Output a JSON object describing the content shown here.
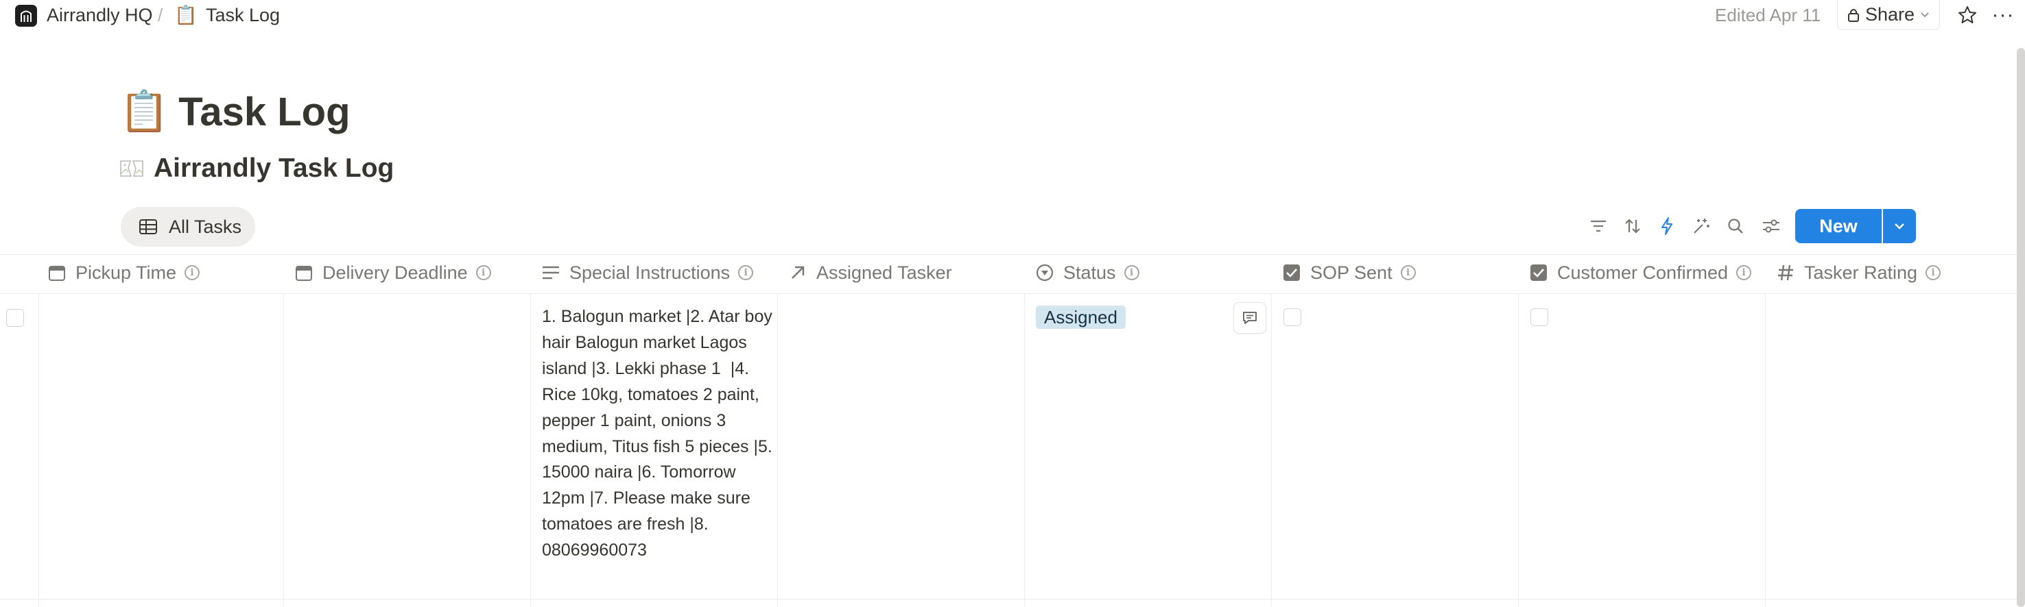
{
  "breadcrumb": {
    "workspace": "Airrandly HQ",
    "separator": "/",
    "page_emoji": "📋",
    "page": "Task Log"
  },
  "topbar": {
    "edited": "Edited Apr 11",
    "share_label": "Share",
    "more_label": "···"
  },
  "page": {
    "emoji": "📋",
    "title": "Task Log"
  },
  "database": {
    "title": "Airrandly Task Log"
  },
  "view_tab": {
    "label": "All Tasks"
  },
  "toolbar": {
    "new_label": "New",
    "accent_color": "#2383e2"
  },
  "columns": [
    {
      "label": "Pickup Time",
      "icon": "calendar-icon"
    },
    {
      "label": "Delivery Deadline",
      "icon": "calendar-icon"
    },
    {
      "label": "Special Instructions",
      "icon": "text-lines-icon"
    },
    {
      "label": "Assigned Tasker",
      "icon": "relation-arrow-icon"
    },
    {
      "label": "Status",
      "icon": "status-icon"
    },
    {
      "label": "SOP Sent",
      "icon": "checkbox-icon"
    },
    {
      "label": "Customer Confirmed",
      "icon": "checkbox-icon"
    },
    {
      "label": "Tasker Rating",
      "icon": "number-icon"
    }
  ],
  "rows": [
    {
      "pickup_time": "",
      "delivery_deadline": "",
      "special_instructions": "1. Balogun market |2. Atar boy hair Balogun market Lagos island |3. Lekki phase 1  |4. Rice 10kg, tomatoes 2 paint, pepper 1 paint, onions 3 medium, Titus fish 5 pieces |5. 15000 naira |6. Tomorrow 12pm |7. Please make sure tomatoes are fresh |8. 08069960073",
      "assigned_tasker": "",
      "status": "Assigned",
      "status_color": "#d3e5ef",
      "sop_sent": false,
      "customer_confirmed": false,
      "tasker_rating": ""
    }
  ]
}
